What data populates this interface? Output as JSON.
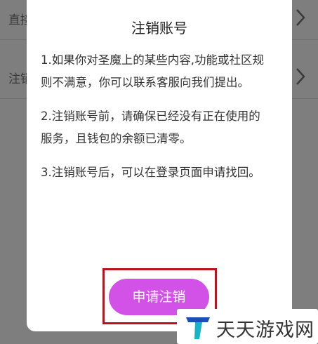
{
  "background": {
    "rows": [
      {
        "label": "直接"
      },
      {
        "label": "注销"
      }
    ]
  },
  "dialog": {
    "title": "注销账号",
    "paragraphs": [
      "1.如果你对圣魔上的某些内容,功能或社区规则不满意，你可以联系客服向我们提出。",
      "2.注销账号前，请确保已经没有正在使用的服务，且钱包的余额已清零。",
      "3.注销账号后，可以在登录页面申请找回。"
    ],
    "apply_button": "申请注销"
  },
  "watermark": {
    "text": "天天游戏网"
  },
  "colors": {
    "button": "#d252e8",
    "highlight_box": "#c0101a",
    "logo_teal": "#17b3c8",
    "logo_blue": "#1a4fb5"
  },
  "icons": [
    "chevron-right-icon",
    "site-logo-icon"
  ]
}
